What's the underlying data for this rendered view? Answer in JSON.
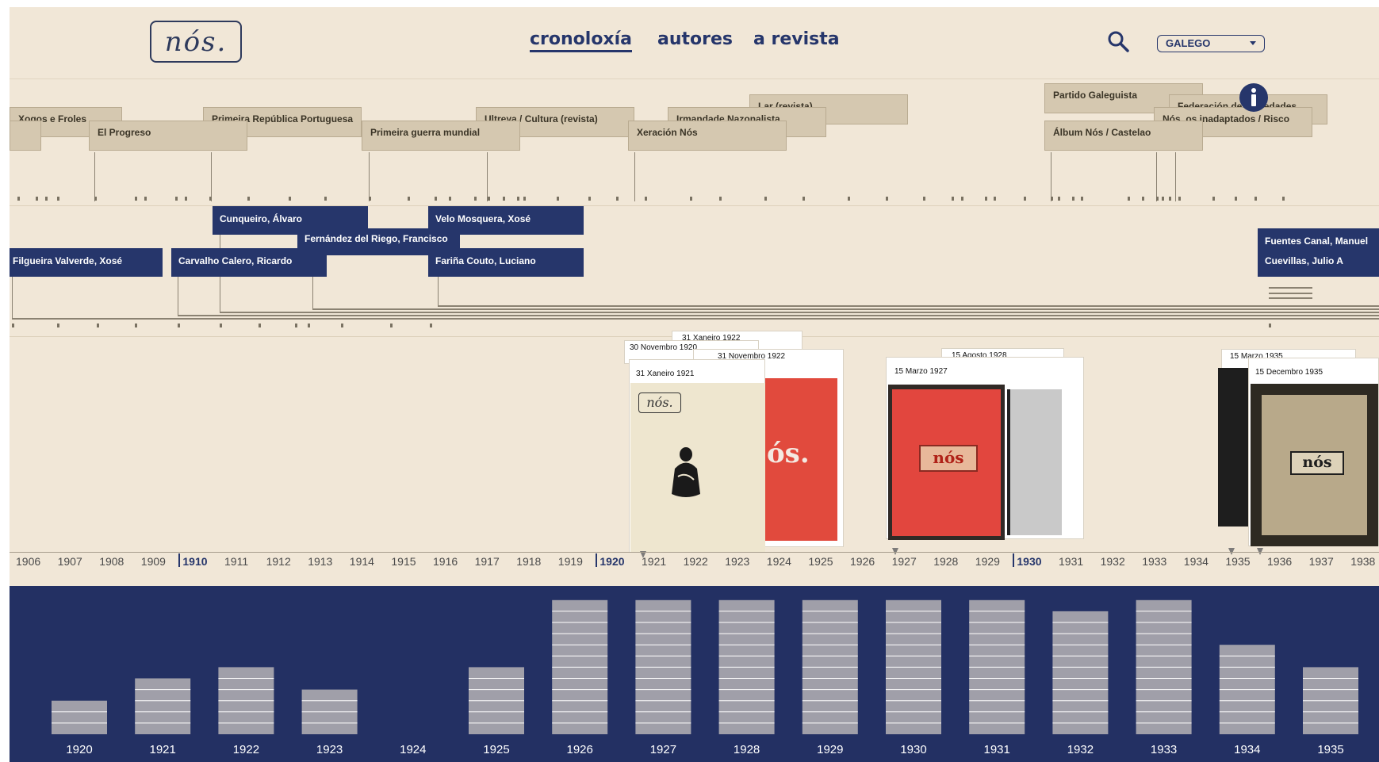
{
  "header": {
    "logo_text": "nós.",
    "nav": [
      {
        "label": "cronoloxía",
        "active": true
      },
      {
        "label": "autores",
        "active": false
      },
      {
        "label": "a revista",
        "active": false
      }
    ],
    "language_select": "GALEGO"
  },
  "events": [
    {
      "label": "Xogos e Froles"
    },
    {
      "label": "El Progreso"
    },
    {
      "label": "Primeira República Portuguesa"
    },
    {
      "label": "Primeira guerra mundial"
    },
    {
      "label": "Ultreya / Cultura (revista)"
    },
    {
      "label": "Xeración Nós"
    },
    {
      "label": "Irmandade Nazonalista"
    },
    {
      "label": "Lar (revista)"
    },
    {
      "label": "Partido Galeguista"
    },
    {
      "label": "Federación de sociedades"
    },
    {
      "label": "Nós, os inadaptados / Risco"
    },
    {
      "label": "Álbum Nós / Castelao"
    }
  ],
  "info_icon": "info-icon",
  "authors": [
    {
      "label": "Filgueira Valverde, Xosé"
    },
    {
      "label": "Cunqueiro, Álvaro"
    },
    {
      "label": "Fernández del Riego, Francisco"
    },
    {
      "label": "Carvalho Calero, Ricardo"
    },
    {
      "label": "Velo Mosquera, Xosé"
    },
    {
      "label": "Fariña Couto, Luciano"
    },
    {
      "label": "Fuentes Canal, Manuel"
    },
    {
      "label": "Cuevillas, Julio A"
    }
  ],
  "covers": [
    {
      "date": "30 Novembro 1920"
    },
    {
      "date": "31 Xaneiro 1921"
    },
    {
      "date": "31 Xaneiro 1922"
    },
    {
      "date": "31 Novembro 1922"
    },
    {
      "date": "15 Marzo 1927"
    },
    {
      "date": "15 Agosto 1928"
    },
    {
      "date": "15 Marzo 1935"
    },
    {
      "date": "15 Decembro 1935"
    }
  ],
  "axis_years": [
    "1906",
    "1907",
    "1908",
    "1909",
    "1910",
    "1911",
    "1912",
    "1913",
    "1914",
    "1915",
    "1916",
    "1917",
    "1918",
    "1919",
    "1920",
    "1921",
    "1922",
    "1923",
    "1924",
    "1925",
    "1926",
    "1927",
    "1928",
    "1929",
    "1930",
    "1931",
    "1932",
    "1933",
    "1934",
    "1935",
    "1936",
    "1937",
    "1938"
  ],
  "axis_decades": [
    "1910",
    "1920",
    "1930"
  ],
  "chart_data": {
    "type": "bar",
    "categories": [
      "1920",
      "1921",
      "1922",
      "1923",
      "1924",
      "1925",
      "1926",
      "1927",
      "1928",
      "1929",
      "1930",
      "1931",
      "1932",
      "1933",
      "1934",
      "1935"
    ],
    "values": [
      3,
      5,
      6,
      4,
      0,
      6,
      12,
      12,
      12,
      12,
      12,
      12,
      11,
      12,
      8,
      6
    ],
    "ylim": [
      0,
      12
    ],
    "colors": {
      "background": "#233063",
      "bar": "#a09fa9",
      "stripe": "#ffffff"
    }
  }
}
